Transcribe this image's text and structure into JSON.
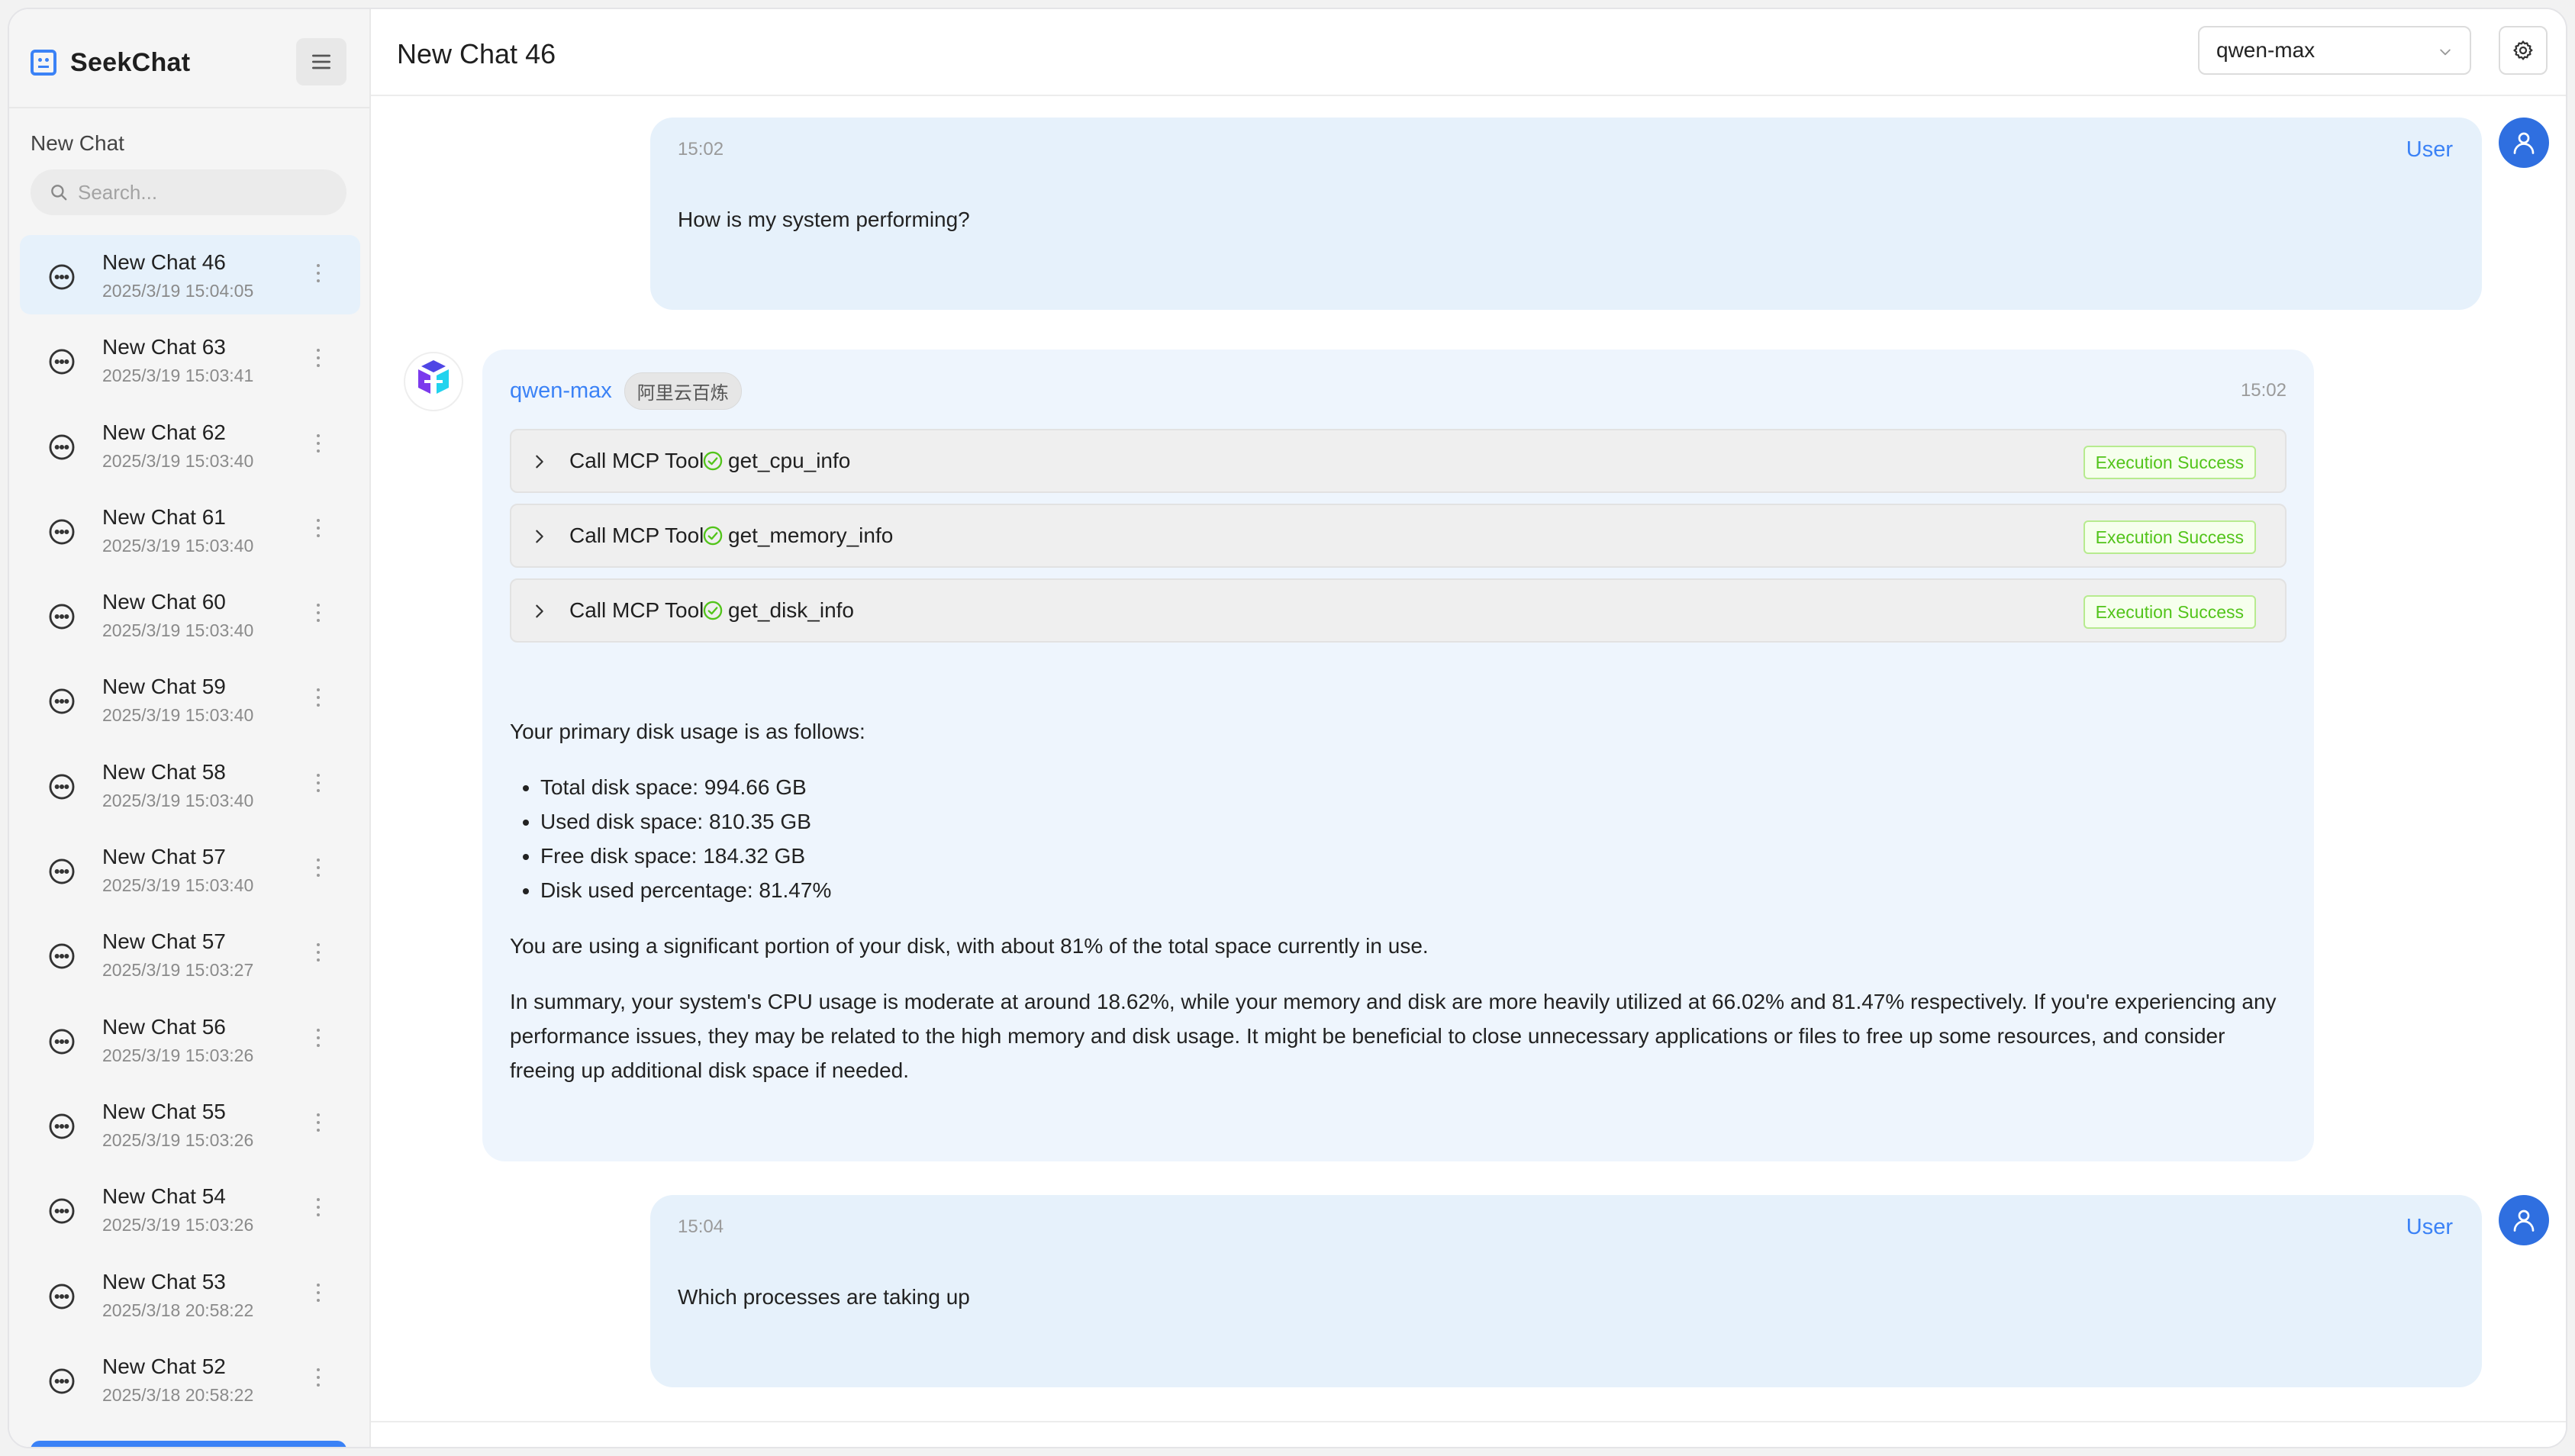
{
  "app": {
    "name": "SeekChat",
    "new_chat_label": "New Chat",
    "search_placeholder": "Search..."
  },
  "sidebar": {
    "chats": [
      {
        "title": "New Chat 46",
        "date": "2025/3/19 15:04:05",
        "active": true
      },
      {
        "title": "New Chat 63",
        "date": "2025/3/19 15:03:41"
      },
      {
        "title": "New Chat 62",
        "date": "2025/3/19 15:03:40"
      },
      {
        "title": "New Chat 61",
        "date": "2025/3/19 15:03:40"
      },
      {
        "title": "New Chat 60",
        "date": "2025/3/19 15:03:40"
      },
      {
        "title": "New Chat 59",
        "date": "2025/3/19 15:03:40"
      },
      {
        "title": "New Chat 58",
        "date": "2025/3/19 15:03:40"
      },
      {
        "title": "New Chat 57",
        "date": "2025/3/19 15:03:40"
      },
      {
        "title": "New Chat 57",
        "date": "2025/3/19 15:03:27"
      },
      {
        "title": "New Chat 56",
        "date": "2025/3/19 15:03:26"
      },
      {
        "title": "New Chat 55",
        "date": "2025/3/19 15:03:26"
      },
      {
        "title": "New Chat 54",
        "date": "2025/3/19 15:03:26"
      },
      {
        "title": "New Chat 53",
        "date": "2025/3/18 20:58:22"
      },
      {
        "title": "New Chat 52",
        "date": "2025/3/18 20:58:22"
      }
    ]
  },
  "header": {
    "title": "New Chat 46",
    "model": "qwen-max"
  },
  "messages": {
    "user1": {
      "time": "15:02",
      "author": "User",
      "text": "How is my system performing?"
    },
    "ai": {
      "model": "qwen-max",
      "provider": "阿里云百炼",
      "time": "15:02",
      "tool_calls": [
        {
          "label": "Call MCP Tool",
          "name": "get_cpu_info",
          "status": "Execution Success"
        },
        {
          "label": "Call MCP Tool",
          "name": "get_memory_info",
          "status": "Execution Success"
        },
        {
          "label": "Call MCP Tool",
          "name": "get_disk_info",
          "status": "Execution Success"
        }
      ],
      "intro": "Your primary disk usage is as follows:",
      "bullets": [
        "Total disk space: 994.66 GB",
        "Used disk space: 810.35 GB",
        "Free disk space: 184.32 GB",
        "Disk used percentage: 81.47%"
      ],
      "para1": "You are using a significant portion of your disk, with about 81% of the total space currently in use.",
      "para2": "In summary, your system's CPU usage is moderate at around 18.62%, while your memory and disk are more heavily utilized at 66.02% and 81.47% respectively. If you're experiencing any performance issues, they may be related to the high memory and disk usage. It might be beneficial to close unnecessary applications or files to free up some resources, and consider freeing up additional disk space if needed."
    },
    "user2": {
      "time": "15:04",
      "author": "User",
      "text": "Which processes are taking up"
    }
  },
  "colors": {
    "accent": "#3b82f6",
    "user_bubble": "#e6f1fb",
    "ai_bubble": "#eef5fd",
    "success": "#52c41a"
  },
  "icons": [
    "app-logo-icon",
    "menu-icon",
    "search-icon",
    "chat-bubble-icon",
    "more-vertical-icon",
    "chevron-down-icon",
    "gear-icon",
    "user-avatar-icon",
    "ai-logo-icon",
    "chevron-right-icon",
    "check-circle-icon"
  ]
}
